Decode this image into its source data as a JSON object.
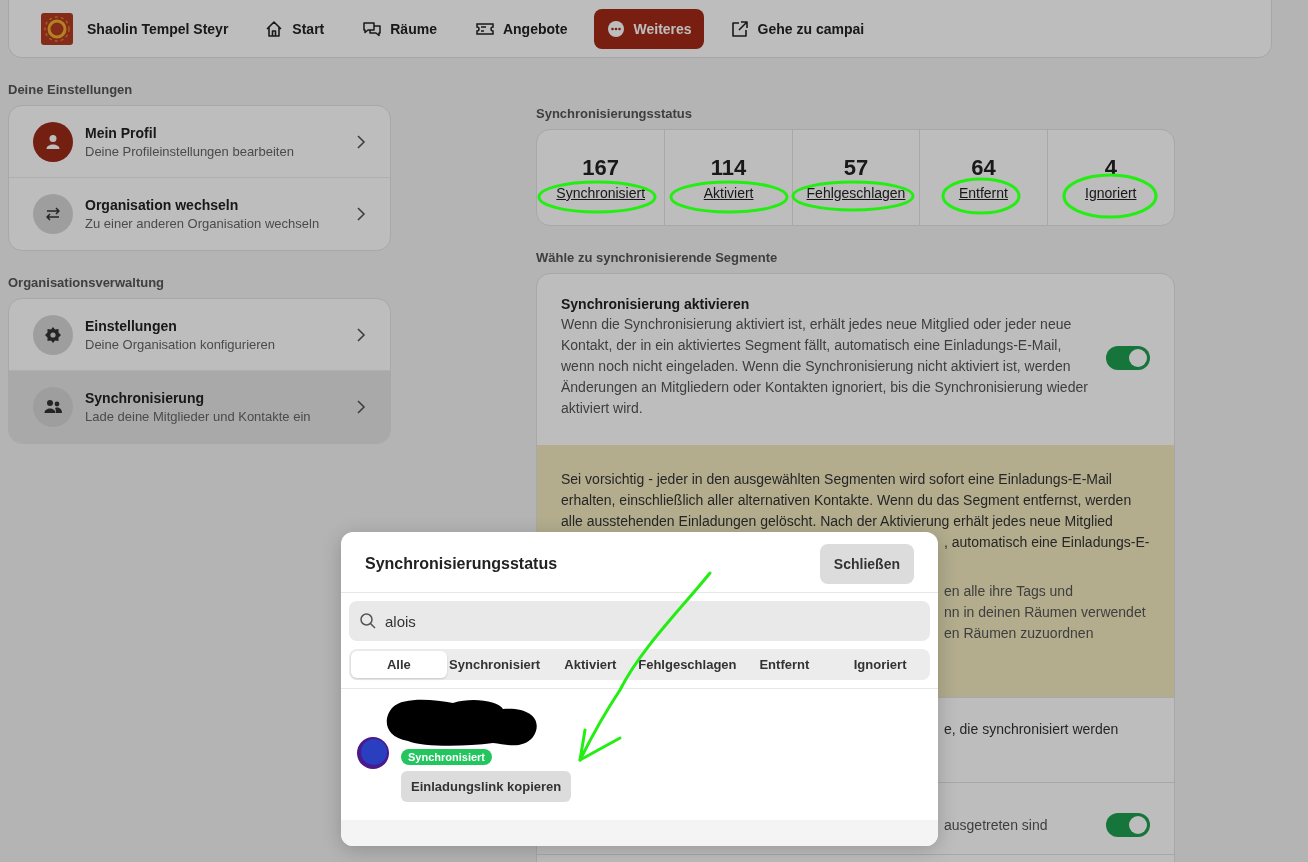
{
  "header": {
    "org_name": "Shaolin Tempel Steyr",
    "nav": [
      {
        "label": "Start",
        "selected": false
      },
      {
        "label": "Räume",
        "selected": false
      },
      {
        "label": "Angebote",
        "selected": false
      },
      {
        "label": "Weiteres",
        "selected": true
      },
      {
        "label": "Gehe zu campai",
        "selected": false
      }
    ]
  },
  "sidebar": {
    "sections": [
      {
        "title": "Deine Einstellungen",
        "items": [
          {
            "title": "Mein Profil",
            "subtitle": "Deine Profileinstellungen bearbeiten",
            "selected": false
          },
          {
            "title": "Organisation wechseln",
            "subtitle": "Zu einer anderen Organisation wechseln",
            "selected": false
          }
        ]
      },
      {
        "title": "Organisationsverwaltung",
        "items": [
          {
            "title": "Einstellungen",
            "subtitle": "Deine Organisation konfigurieren",
            "selected": false
          },
          {
            "title": "Synchronisierung",
            "subtitle": "Lade deine Mitglieder und Kontakte ein",
            "selected": true
          }
        ]
      }
    ]
  },
  "sync_status": {
    "title": "Synchronisierungsstatus",
    "stats": [
      {
        "count": "167",
        "label": "Synchronisiert"
      },
      {
        "count": "114",
        "label": "Aktiviert"
      },
      {
        "count": "57",
        "label": "Fehlgeschlagen"
      },
      {
        "count": "64",
        "label": "Entfernt"
      },
      {
        "count": "4",
        "label": "Ignoriert"
      }
    ]
  },
  "segments": {
    "title": "Wähle zu synchronisierende Segmente",
    "enable": {
      "title": "Synchronisierung aktivieren",
      "text": "Wenn die Synchronisierung aktiviert ist, erhält jedes neue Mitglied oder jeder neue Kontakt, der in ein aktiviertes Segment fällt, automatisch eine Einladungs-E-Mail, wenn noch nicht eingeladen. Wenn die Synchronisierung nicht aktiviert ist, werden Änderungen an Mitgliedern oder Kontakten ignoriert, bis die Synchronisierung wieder aktiviert wird.",
      "on": true
    },
    "warning": {
      "lines": [
        "Sei vorsichtig - jeder in den ausgewählten Segmenten wird sofort eine Einladungs-E-Mail",
        "erhalten, einschließlich aller alternativen Kontakte. Wenn du das Segment entfernst, werden",
        "alle ausstehenden Einladungen gelöscht. Nach der Aktivierung erhält jedes neue Mitglied"
      ],
      "fragments": [
        ", automatisch eine Einladungs-E-"
      ],
      "note_fragments": [
        "en alle ihre Tags und",
        "nn in deinen Räumen verwendet",
        "en Räumen zuzuordnen"
      ]
    },
    "rows": [
      {
        "text": "e, die synchronisiert werden"
      },
      {
        "text": "ausgetreten sind",
        "on": true
      }
    ]
  },
  "modal": {
    "title": "Synchronisierungsstatus",
    "close_label": "Schließen",
    "search": {
      "value": "alois"
    },
    "filters": [
      {
        "label": "Alle",
        "selected": true
      },
      {
        "label": "Synchronisiert",
        "selected": false
      },
      {
        "label": "Aktiviert",
        "selected": false
      },
      {
        "label": "Fehlgeschlagen",
        "selected": false
      },
      {
        "label": "Entfernt",
        "selected": false
      },
      {
        "label": "Ignoriert",
        "selected": false
      }
    ],
    "results": [
      {
        "status": "Synchronisiert",
        "action": "Einladungslink kopieren"
      }
    ]
  }
}
